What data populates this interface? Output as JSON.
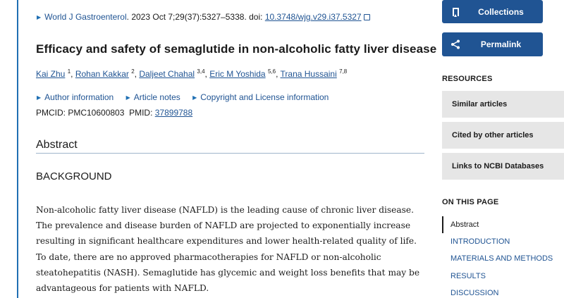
{
  "citation": {
    "journal": "World J Gastroenterol",
    "details": ". 2023 Oct 7;29(37):5327–5338. doi: ",
    "doi": "10.3748/wjg.v29.i37.5327"
  },
  "title": "Efficacy and safety of semaglutide in non-alcoholic fatty liver disease",
  "authors": [
    {
      "name": "Kai Zhu",
      "aff": "1"
    },
    {
      "name": "Rohan Kakkar",
      "aff": "2"
    },
    {
      "name": "Daljeet Chahal",
      "aff": "3,4"
    },
    {
      "name": "Eric M Yoshida",
      "aff": "5,6"
    },
    {
      "name": "Trana Hussaini",
      "aff": "7,8"
    }
  ],
  "info_links": {
    "author_info": "Author information",
    "article_notes": "Article notes",
    "copyright": "Copyright and License information"
  },
  "ids": {
    "pmcid_label": "PMCID: ",
    "pmcid": "PMC10600803",
    "pmid_label": "PMID: ",
    "pmid": "37899788"
  },
  "abstract": {
    "heading": "Abstract",
    "section": "BACKGROUND",
    "text": "Non-alcoholic fatty liver disease (NAFLD) is the leading cause of chronic liver disease. The prevalence and disease burden of NAFLD are projected to exponentially increase resulting in significant healthcare expenditures and lower health-related quality of life. To date, there are no approved pharmacotherapies for NAFLD or non-alcoholic steatohepatitis (NASH). Semaglutide has glycemic and weight loss benefits that may be advantageous for patients with NAFLD."
  },
  "sidebar": {
    "collections": "Collections",
    "permalink": "Permalink",
    "resources_heading": "RESOURCES",
    "resources": [
      "Similar articles",
      "Cited by other articles",
      "Links to NCBI Databases"
    ],
    "on_this_page_heading": "ON THIS PAGE",
    "on_this_page": [
      "Abstract",
      "INTRODUCTION",
      "MATERIALS AND METHODS",
      "RESULTS",
      "DISCUSSION"
    ]
  },
  "colors": {
    "accent": "#205493",
    "panel": "#e6e6e6"
  },
  "icons": [
    "bookmark-icon",
    "share-icon",
    "external-link-icon",
    "triangle-bullet-icon"
  ]
}
